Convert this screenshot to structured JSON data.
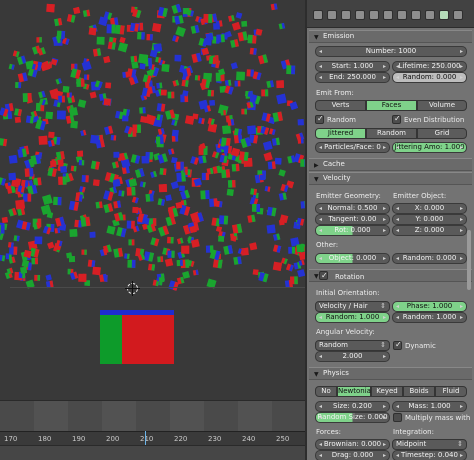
{
  "viewport": {
    "particle_colors": [
      "#d71f24",
      "#1aa52f",
      "#2432d4"
    ],
    "emitter_colors": {
      "front": "#0d9b2a",
      "side": "#d21a1e",
      "top": "#1e2cd1"
    }
  },
  "timeline": {
    "ticks": [
      "170",
      "180",
      "190",
      "200",
      "210",
      "220",
      "230",
      "240",
      "250"
    ]
  },
  "panel": {
    "tabs": [
      "render-icon",
      "scene-icon",
      "world-icon",
      "object-icon",
      "constraints-icon",
      "modifiers-icon",
      "data-icon",
      "material-icon",
      "texture-icon",
      "particles-icon",
      "physics-icon"
    ],
    "emission": {
      "title": "Emission",
      "number": "Number: 1000",
      "start": "Start: 1.000",
      "lifetime": "Lifetime: 250.000",
      "end": "End: 250.000",
      "random": "Random: 0.000",
      "emit_from_label": "Emit From:",
      "emit_from": [
        "Verts",
        "Faces",
        "Volume"
      ],
      "random_check": "Random",
      "even_distribution": "Even Distribution",
      "distribution": [
        "Jittered",
        "Random",
        "Grid"
      ],
      "particles_face": "Particles/Face: 0",
      "jittering_amount": "Jittering Amo: 1.000"
    },
    "cache": {
      "title": "Cache"
    },
    "velocity": {
      "title": "Velocity",
      "emitter_geometry": "Emitter Geometry:",
      "emitter_object": "Emitter Object:",
      "normal": "Normal: 0.500",
      "tangent": "Tangent: 0.00",
      "rot": "Rot: 0.000",
      "x": "X: 0.000",
      "y": "Y: 0.000",
      "z": "Z: 0.000",
      "other": "Other:",
      "object": "Object: 0.000",
      "random": "Random: 0.000"
    },
    "rotation": {
      "title": "Rotation",
      "initial_orientation": "Initial Orientation:",
      "velocity_hair": "Velocity / Hair",
      "phase": "Phase: 1.000",
      "random1": "Random: 1.000",
      "random2": "Random: 1.000",
      "angular_velocity": "Angular Velocity:",
      "random_dd": "Random",
      "dynamic": "Dynamic",
      "value": "2.000"
    },
    "physics": {
      "title": "Physics",
      "types": [
        "No",
        "Newtonia",
        "Keyed",
        "Boids",
        "Fluid"
      ],
      "size": "Size: 0.200",
      "mass": "Mass: 1.000",
      "random_size": "Random Size: 0.000",
      "multiply_mass": "Multiply mass with",
      "forces": "Forces:",
      "integration": "Integration:",
      "brownian": "Brownian: 0.000",
      "midpoint": "Midpoint",
      "drag": "Drag: 0.000",
      "timestep": "Timestep: 0.040"
    }
  }
}
